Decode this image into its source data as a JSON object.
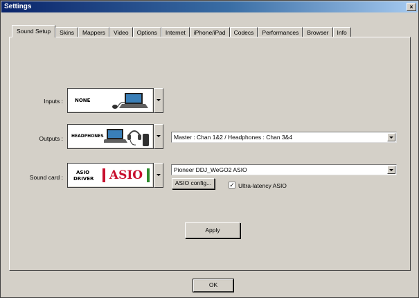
{
  "window": {
    "title": "Settings",
    "close_label": "×"
  },
  "tabs": [
    "Sound Setup",
    "Skins",
    "Mappers",
    "Video",
    "Options",
    "Internet",
    "iPhone/iPad",
    "Codecs",
    "Performances",
    "Browser",
    "Info"
  ],
  "sound_setup": {
    "inputs": {
      "label": "Inputs :",
      "value": "NONE"
    },
    "outputs": {
      "label": "Outputs :",
      "value": "HEADPHONES",
      "channel_select": "Master : Chan 1&2 / Headphones : Chan 3&4"
    },
    "sound_card": {
      "label": "Sound card :",
      "value_line1": "ASIO",
      "value_line2": "DRIVER",
      "logo_text": "ASIO",
      "device_select": "Pioneer DDJ_WeGO2 ASIO",
      "config_button": "ASIO config...",
      "ultra_latency_label": "Ultra-latency ASIO",
      "ultra_latency_checked": "✓"
    },
    "apply_button": "Apply"
  },
  "footer": {
    "ok_button": "OK"
  },
  "colors": {
    "face": "#d4d0c8",
    "title_start": "#0a246a",
    "title_end": "#a6caf0",
    "asio_red": "#c8102e"
  }
}
